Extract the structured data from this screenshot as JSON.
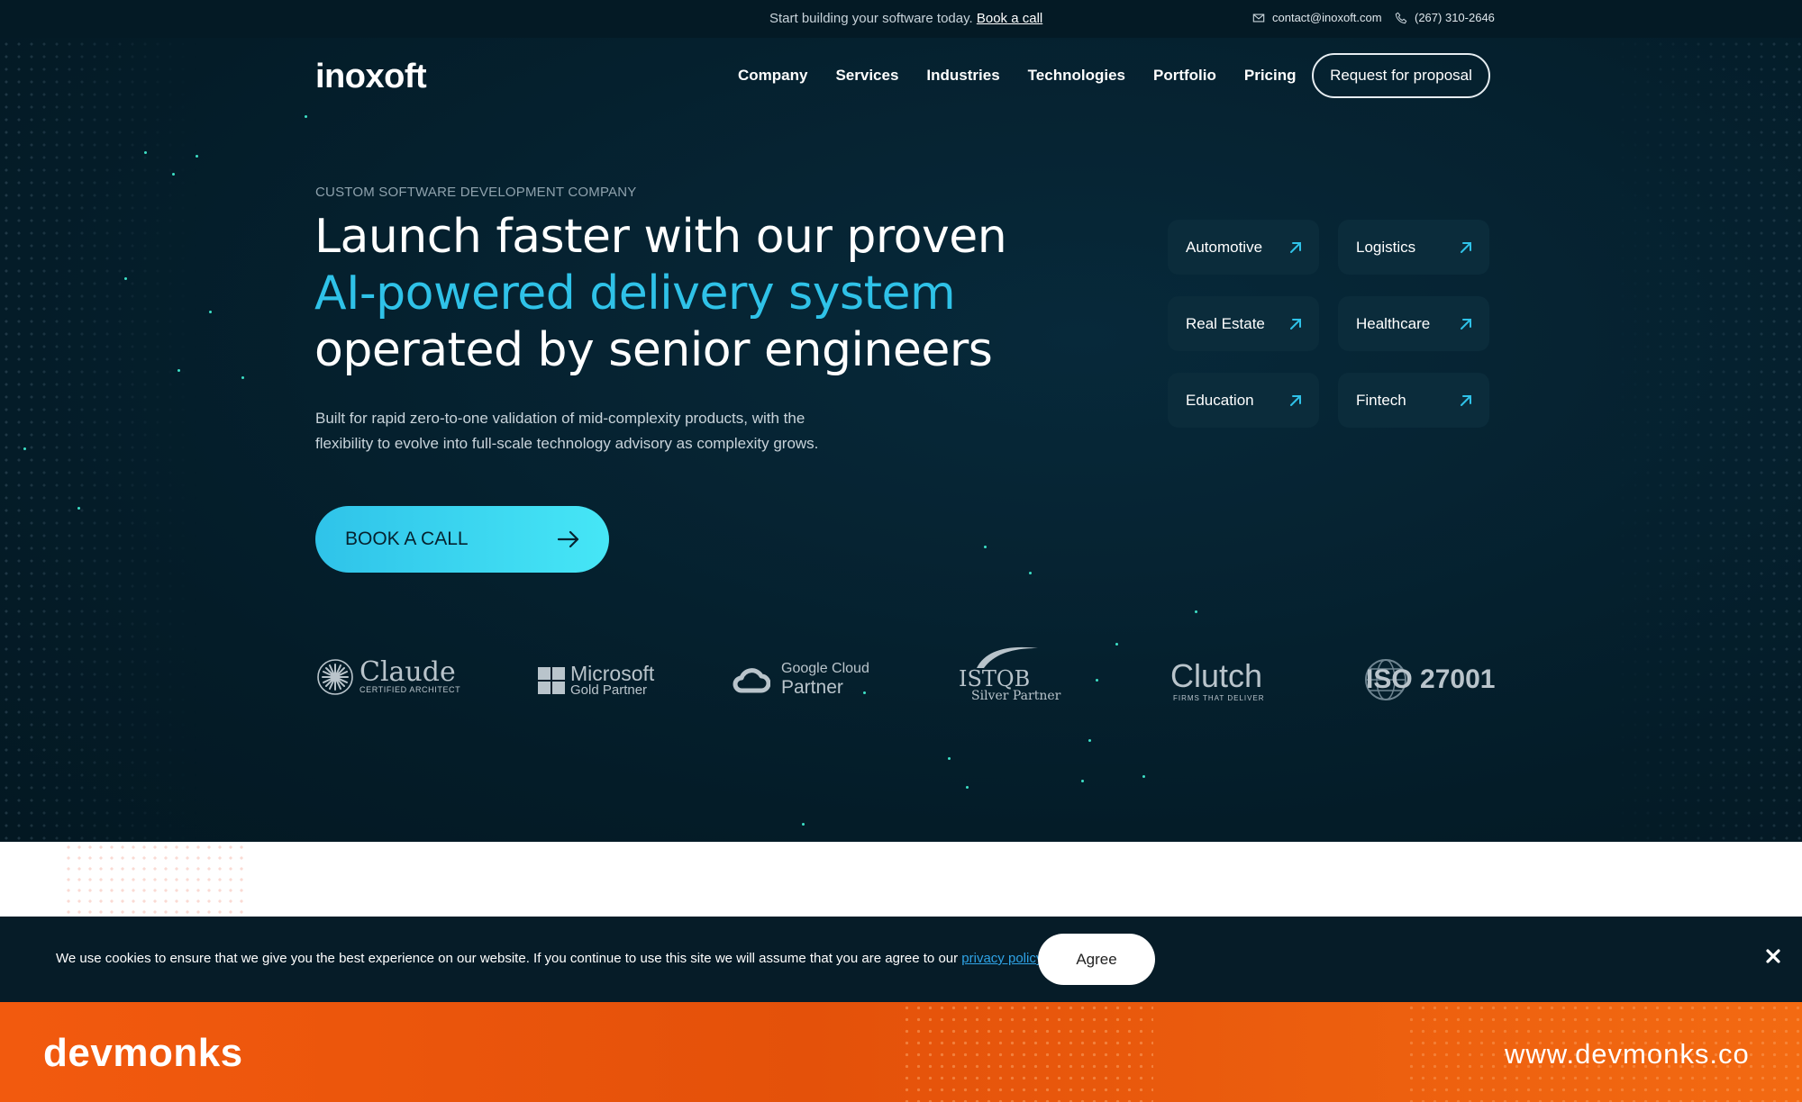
{
  "topbar": {
    "promo_text": "Start building your software today.",
    "promo_link": "Book a call",
    "email": "contact@inoxoft.com",
    "phone": "(267) 310-2646"
  },
  "header": {
    "logo": "inoxoft",
    "nav": [
      "Company",
      "Services",
      "Industries",
      "Technologies",
      "Portfolio",
      "Pricing"
    ],
    "proposal_button": "Request for proposal"
  },
  "hero": {
    "eyebrow": "CUSTOM SOFTWARE DEVELOPMENT COMPANY",
    "headline_line1": "Launch faster with our proven",
    "headline_accent": "AI-powered delivery system",
    "headline_line3": "operated by senior engineers",
    "lead": "Built for rapid zero-to-one validation of mid-complexity products, with the flexibility to evolve into full-scale technology advisory as complexity grows.",
    "cta": "BOOK A CALL"
  },
  "industries": [
    "Automotive",
    "Logistics",
    "Real Estate",
    "Healthcare",
    "Education",
    "Fintech"
  ],
  "partners": {
    "claude_name": "Claude",
    "claude_sub": "CERTIFIED ARCHITECT",
    "microsoft_name": "Microsoft",
    "microsoft_sub": "Gold Partner",
    "google_name": "Google Cloud",
    "google_sub": "Partner",
    "istqb_name": "ISTQB",
    "istqb_sub": "Silver Partner",
    "clutch_name": "Clutch",
    "clutch_sub": "FIRMS THAT DELIVER",
    "iso_name": "ISO 27001"
  },
  "cookie": {
    "text": "We use cookies to ensure that we give you the best experience on our website. If you continue to use this site we will assume that you are agree to our",
    "link": "privacy policy",
    "suffix": ".",
    "agree": "Agree"
  },
  "brandbar": {
    "logo": "devmonks",
    "url": "www.devmonks.co"
  },
  "colors": {
    "background": "#04202c",
    "accent": "#2fc2e8",
    "cta_gradient_end": "#46e6f6",
    "brand_orange": "#f25a0e"
  }
}
